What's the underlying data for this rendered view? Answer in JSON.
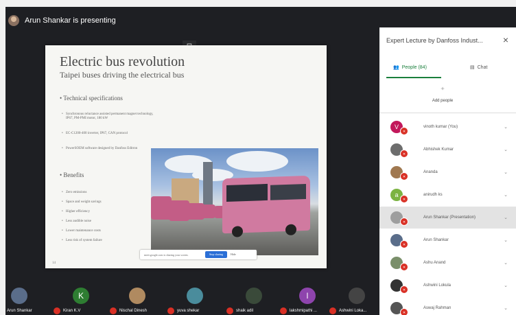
{
  "meeting": {
    "presenting_text": "Arun Shankar is presenting"
  },
  "slide": {
    "title": "Electric bus revolution",
    "subtitle": "Taipei buses driving the electrical bus",
    "section1": "Technical specifications",
    "bullets1": [
      "Synchronous reluctance assisted permanent magnet technology, IP67, PM-PMI motor, 180 kW",
      "EC-C1200-400 inverter, IP67, CAN protocol",
      "PowerSOEM software designed by Danfoss Editron"
    ],
    "section2": "Benefits",
    "bullets2": [
      "Zero emissions",
      "Space and weight savings",
      "Higher efficiency",
      "Less audible noise",
      "Lower maintenance costs",
      "Less risk of system failure"
    ],
    "page_number": "14",
    "share_bar_text": "meet.google.com is sharing your screen.",
    "stop_sharing_label": "Stop sharing",
    "hide_label": "Hide"
  },
  "panel": {
    "title": "Expert Lecture by Danfoss Indust...",
    "close_icon": "×",
    "tab_people": "People (84)",
    "tab_chat": "Chat",
    "add_people_label": "Add people",
    "participants": [
      {
        "name": "vinoth kumar (You)",
        "initial": "V",
        "color": "#c2185b"
      },
      {
        "name": "Abhishek Kumar",
        "initial": "",
        "color": "#6d6d6d"
      },
      {
        "name": "Ananda",
        "initial": "",
        "color": "#a07850"
      },
      {
        "name": "anirudh ks",
        "initial": "a",
        "color": "#7cb342"
      },
      {
        "name": "Arun Shankar (Presentation)",
        "initial": "",
        "color": "#9e9e9e"
      },
      {
        "name": "Arun Shankar",
        "initial": "",
        "color": "#5a6d8a"
      },
      {
        "name": "Ashu Anand",
        "initial": "",
        "color": "#7a8f6a"
      },
      {
        "name": "Ashwini Lokula",
        "initial": "",
        "color": "#333333"
      },
      {
        "name": "Aswaj Rahman",
        "initial": "",
        "color": "#555555"
      }
    ]
  },
  "filmstrip": [
    {
      "name": "Arun Shankar",
      "initial": "",
      "color": "#5a6d8a",
      "mic": false
    },
    {
      "name": "Kiran K.V",
      "initial": "K",
      "color": "#2e7d32",
      "mic": true
    },
    {
      "name": "Nischal Dinesh",
      "initial": "",
      "color": "#b08a60",
      "mic": true
    },
    {
      "name": "yuva shekar",
      "initial": "",
      "color": "#4a8c9c",
      "mic": true
    },
    {
      "name": "shaik adil",
      "initial": "",
      "color": "#3a4a3a",
      "mic": true
    },
    {
      "name": "lakshmipathi ...",
      "initial": "l",
      "color": "#8e44ad",
      "mic": true
    },
    {
      "name": "Ashwini Loka...",
      "initial": "",
      "color": "#444444",
      "mic": true
    }
  ],
  "colors": {
    "accent": "#1a7f3c",
    "mic_off": "#d93025",
    "stop_button": "#2b6fd6"
  }
}
